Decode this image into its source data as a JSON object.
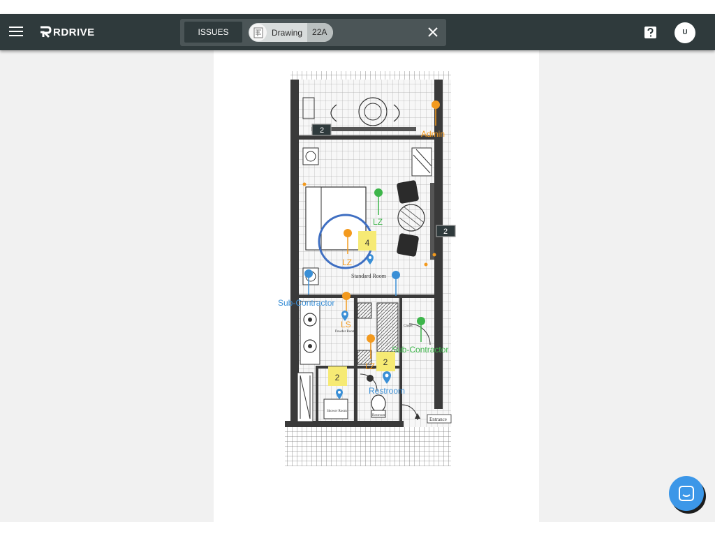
{
  "app": {
    "logo_text": "RDRIVE",
    "menu_icon": "hamburger-menu-icon",
    "help_icon": "help-icon",
    "user_initial": "U"
  },
  "filter_bar": {
    "issues_label": "ISSUES",
    "chip": {
      "label": "Drawing",
      "value": "22A",
      "icon": "drawing-thumbnail-icon"
    },
    "close_icon": "close-icon"
  },
  "drawing": {
    "room_labels": {
      "standard_room": "Standard Room",
      "restroom_small": "Restroom",
      "entrance": "Entrance",
      "shower_room": "Shower Room",
      "powder_room": "Powder Room",
      "closet": "Closet"
    },
    "pins": [
      {
        "label": "Admin",
        "color": "#f39a1e",
        "kind": "round"
      },
      {
        "label": "LZ",
        "color": "#3db54a",
        "kind": "round"
      },
      {
        "label": "LZ",
        "color": "#f39a1e",
        "kind": "round"
      },
      {
        "label": "Sub-Contractor",
        "color": "#3a8fd6",
        "kind": "round"
      },
      {
        "label": "LS",
        "color": "#f39a1e",
        "kind": "round"
      },
      {
        "label": "Sub-Contractor",
        "color": "#3db54a",
        "kind": "round"
      },
      {
        "label": "LZ",
        "color": "#f39a1e",
        "kind": "round"
      },
      {
        "label": "Restroom",
        "color": "#3a8fd6",
        "kind": "drop"
      }
    ],
    "cluster_badges": [
      {
        "count": "2",
        "style": "dark"
      },
      {
        "count": "2",
        "style": "dark"
      },
      {
        "count": "4",
        "style": "yellow"
      },
      {
        "count": "2",
        "style": "yellow"
      },
      {
        "count": "2",
        "style": "yellow"
      }
    ]
  },
  "chat": {
    "icon": "chat-widget-icon"
  },
  "colors": {
    "appbar": "#2f3a3c",
    "accent": "#3c97e8",
    "selection_ring": "#3f6fc2"
  }
}
